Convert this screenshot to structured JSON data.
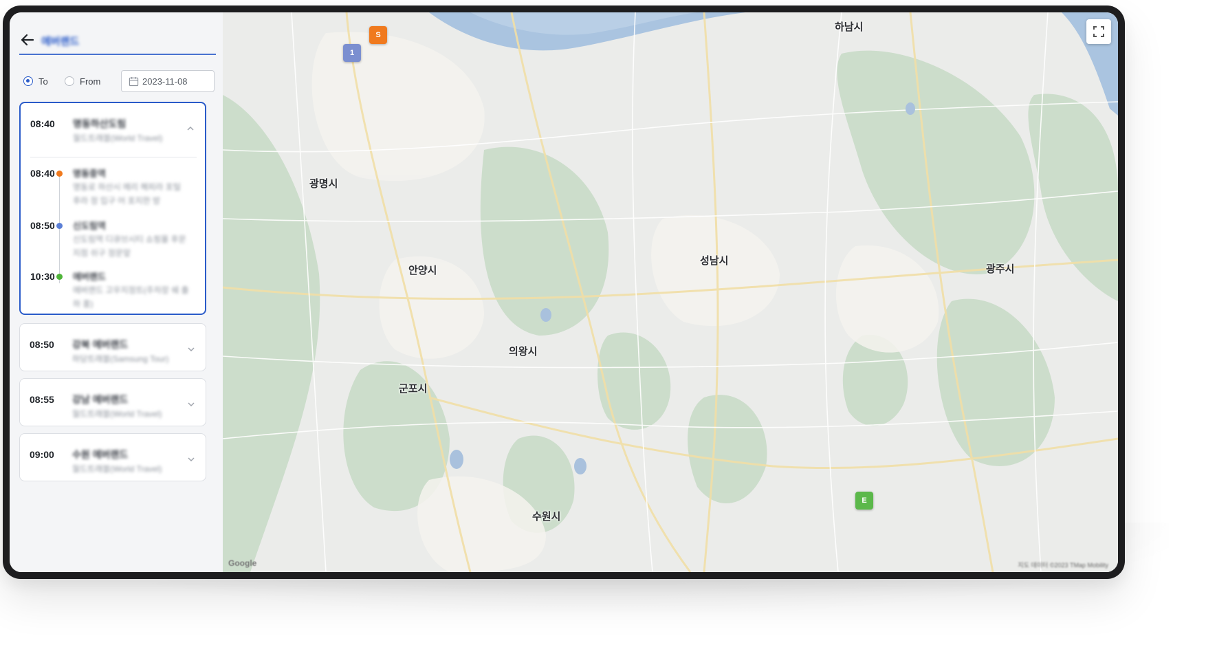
{
  "header": {
    "title": "에버랜드"
  },
  "direction": {
    "to_label": "To",
    "from_label": "From",
    "selected": "To",
    "date": "2023-11-08"
  },
  "routes": [
    {
      "time": "08:40",
      "title": "명동하산도림",
      "subtitle": "월드트래블(World Travel)",
      "expanded": true,
      "stops": [
        {
          "time": "08:40",
          "name": "명동중역",
          "desc": "명동로 하산시 메리 해피라 포털 후라 정 입구 어 포지한 방",
          "color": "#f07a1e"
        },
        {
          "time": "08:50",
          "name": "신도림역",
          "desc": "신도림역 디큐브시티 쇼핑몰 후문지점 쉬구 정문앞",
          "color": "#5b7fd6"
        },
        {
          "time": "10:30",
          "name": "에버랜드",
          "desc": "에버랜드 고우지정트(주차장 쉐 출하 홍)",
          "color": "#4fb53a"
        }
      ]
    },
    {
      "time": "08:50",
      "title": "강북 에버랜드",
      "subtitle": "하당트래블(Samsung Tour)",
      "expanded": false
    },
    {
      "time": "08:55",
      "title": "강남 에버랜드",
      "subtitle": "월드트래블(World Travel)",
      "expanded": false
    },
    {
      "time": "09:00",
      "title": "수원 에버랜드",
      "subtitle": "월드트래블(World Travel)",
      "expanded": false
    }
  ],
  "map": {
    "cities": [
      "하남시",
      "광명시",
      "안양시",
      "성남시",
      "광주시",
      "의왕시",
      "군포시",
      "수원시"
    ],
    "markers": [
      {
        "label": "S",
        "color": "#f07a1e"
      },
      {
        "label": "1",
        "color": "#7b8fd0"
      },
      {
        "label": "E",
        "color": "#5bb84a"
      }
    ],
    "attribution": "지도 데이터 ©2023 TMap Mobility",
    "logo": "Google"
  }
}
